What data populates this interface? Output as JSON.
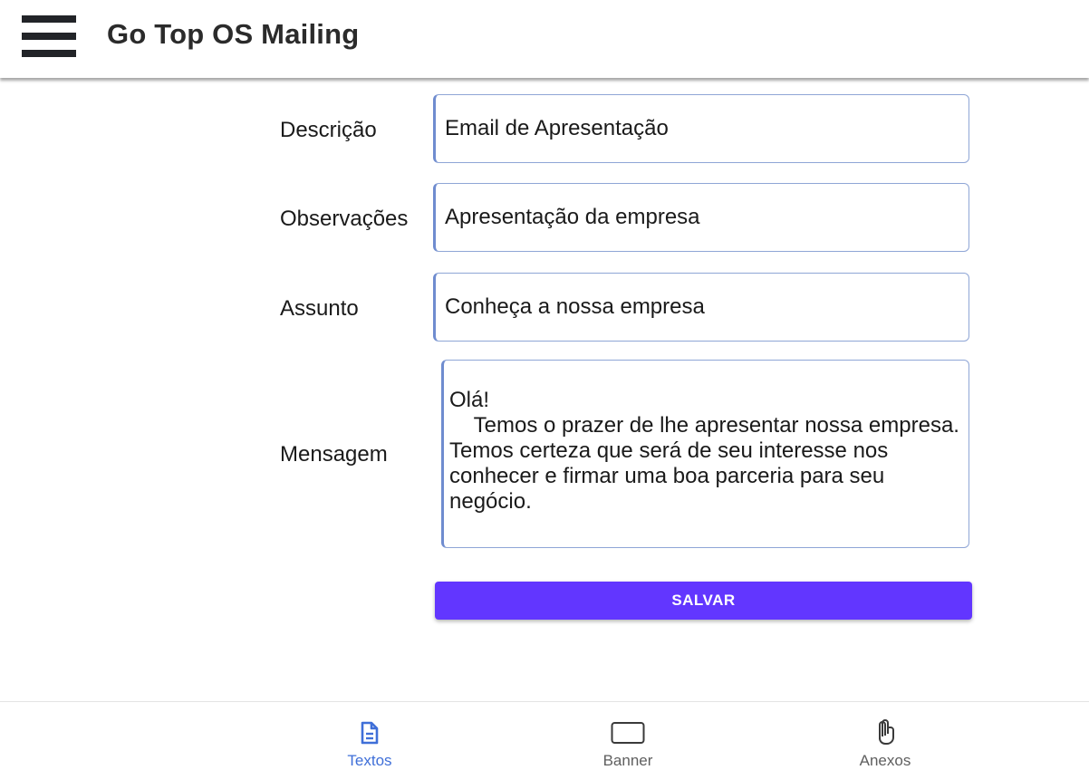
{
  "header": {
    "title": "Go Top OS Mailing"
  },
  "form": {
    "descricao": {
      "label": "Descrição",
      "value": "Email de Apresentação"
    },
    "observacoes": {
      "label": "Observações",
      "value": "Apresentação da empresa"
    },
    "assunto": {
      "label": "Assunto",
      "value": "Conheça a nossa empresa"
    },
    "mensagem": {
      "label": "Mensagem",
      "value": "Olá!\n    Temos o prazer de lhe apresentar nossa empresa. Temos certeza que será de seu interesse nos conhecer e firmar uma boa parceria para seu negócio."
    },
    "save_label": "SALVAR"
  },
  "bottom_nav": {
    "items": [
      {
        "label": "Textos",
        "icon": "document-icon",
        "active": true
      },
      {
        "label": "Banner",
        "icon": "rectangle-icon",
        "active": false
      },
      {
        "label": "Anexos",
        "icon": "paperclip-icon",
        "active": false
      }
    ]
  },
  "colors": {
    "accent": "#6236ff",
    "active_tab": "#3f6fd8",
    "field_border": "#8fa6d6"
  }
}
